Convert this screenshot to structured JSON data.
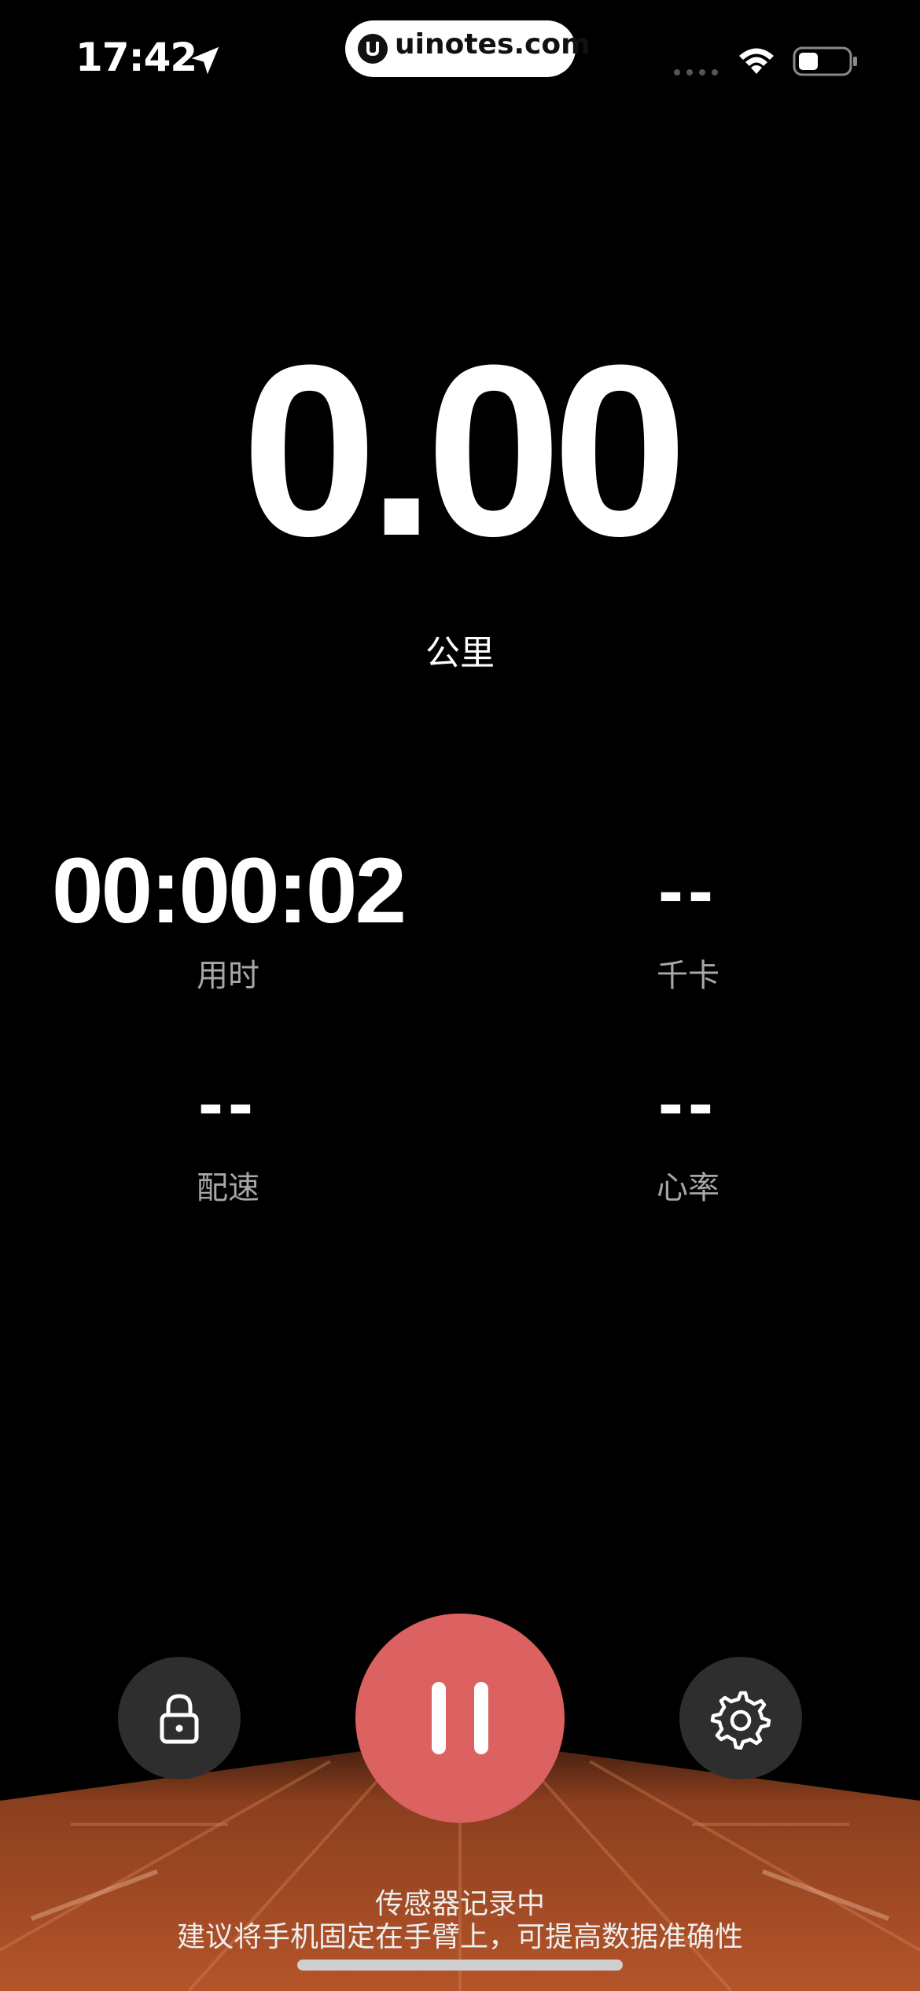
{
  "status_bar": {
    "time": "17:42",
    "watermark": "uinotes.com",
    "icons": [
      "location-arrow-icon",
      "cellular-signal-icon",
      "wifi-icon",
      "battery-icon"
    ],
    "battery_level": 0.3
  },
  "distance": {
    "value": "0.00",
    "unit": "公里"
  },
  "stats": {
    "duration": {
      "value": "00:00:02",
      "label": "用时"
    },
    "calories": {
      "value": "--",
      "label": "千卡"
    },
    "pace": {
      "value": "--",
      "label": "配速"
    },
    "heart_rate": {
      "value": "--",
      "label": "心率"
    }
  },
  "controls": {
    "lock_icon": "lock-icon",
    "pause_icon": "pause-icon",
    "settings_icon": "gear-icon"
  },
  "footer": {
    "status": "传感器记录中",
    "tip": "建议将手机固定在手臂上，可提高数据准确性"
  },
  "colors": {
    "background": "#000000",
    "pause_button": "#dc6161",
    "side_button": "#2e2e2e",
    "track": "#b5542a",
    "label_gray": "#a7a7a7"
  }
}
